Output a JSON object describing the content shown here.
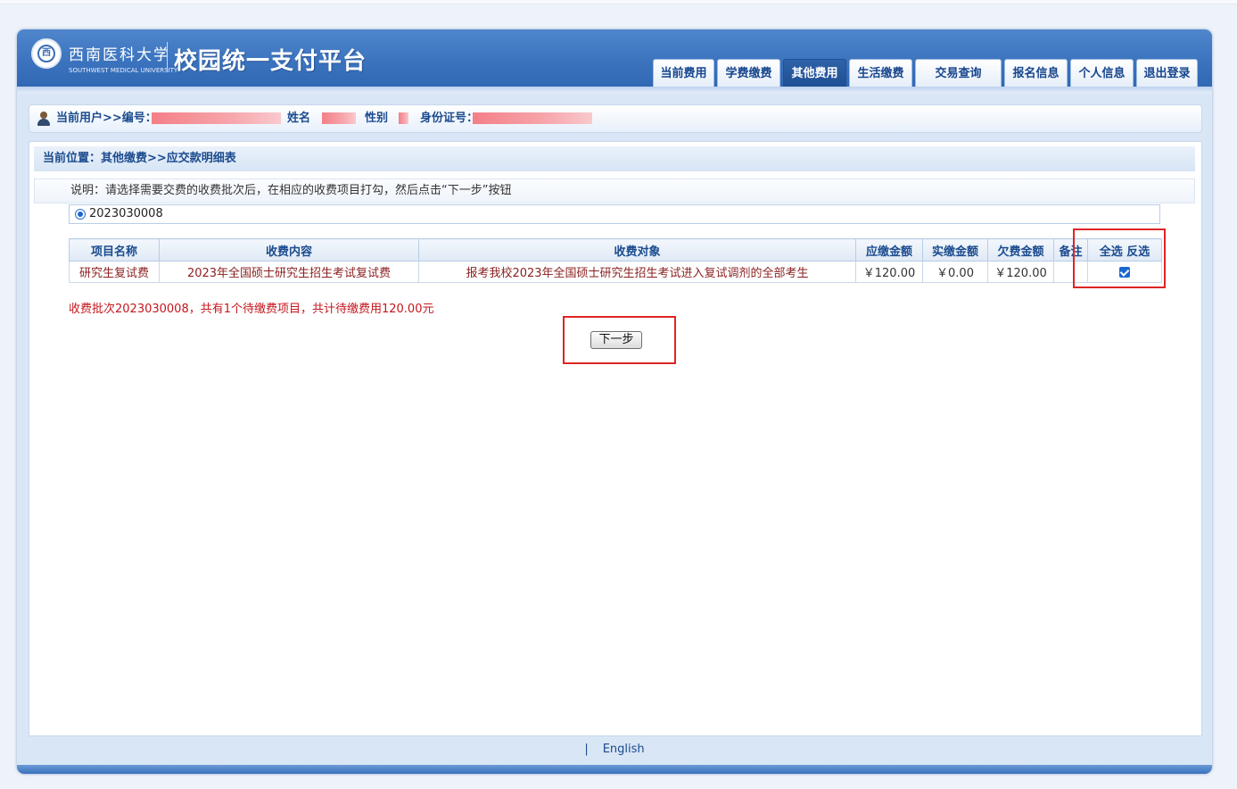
{
  "header": {
    "university_cn": "西南医科大学",
    "university_en": "SOUTHWEST MEDICAL UNIVERSITY",
    "platform_title": "校园统一支付平台"
  },
  "nav": [
    {
      "label": "当前费用",
      "active": false
    },
    {
      "label": "学费缴费",
      "active": false
    },
    {
      "label": "其他费用",
      "active": true
    },
    {
      "label": "生活缴费",
      "active": false
    },
    {
      "label": "交易查询",
      "active": false
    },
    {
      "label": "报名信息",
      "active": false
    },
    {
      "label": "个人信息",
      "active": false
    },
    {
      "label": "退出登录",
      "active": false
    }
  ],
  "userbar": {
    "current_user_label": "当前用户>>编号：",
    "name_label": "姓名",
    "gender_label": "性别",
    "id_label": "身份证号："
  },
  "breadcrumb": "当前位置：其他缴费>>应交款明细表",
  "note": "说明：请选择需要交费的收费批次后，在相应的收费项目打勾，然后点击“下一步”按钮",
  "batch": {
    "number": "2023030008",
    "selected": true
  },
  "table": {
    "headers": [
      "项目名称",
      "收费内容",
      "收费对象",
      "应缴金额",
      "实缴金额",
      "欠费金额",
      "备注",
      "全选 反选"
    ],
    "rows": [
      {
        "item": "研究生复试费",
        "content": "2023年全国硕士研究生招生考试复试费",
        "target": "报考我校2023年全国硕士研究生招生考试进入复试调剂的全部考生",
        "due": "￥120.00",
        "paid": "￥0.00",
        "owed": "￥120.00",
        "remark": "",
        "checked": true
      }
    ]
  },
  "summary": "收费批次2023030008，共有1个待缴费项目，共计待缴费用120.00元",
  "next_button": "下一步",
  "footer": {
    "separator": "|",
    "language": "English"
  },
  "colors": {
    "header_blue": "#3a72bd",
    "active_tab": "#1f4f94",
    "label_blue": "#1b4b8e",
    "summary_red": "#c4161c",
    "highlight_red": "#e02424"
  }
}
